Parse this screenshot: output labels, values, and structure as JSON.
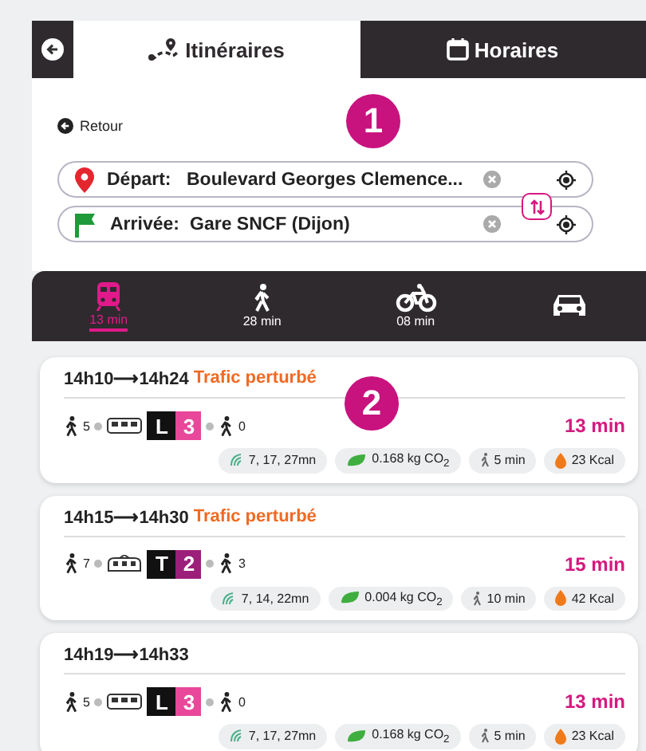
{
  "header": {
    "tabs": [
      {
        "label": "Itinéraires",
        "kind": "route",
        "selected": true
      },
      {
        "label": "Horaires",
        "kind": "calendar",
        "selected": false
      }
    ]
  },
  "form": {
    "back_link": "Retour",
    "fields": [
      {
        "kind": "start",
        "label": "Départ:",
        "value": "Boulevard Georges Clemence..."
      },
      {
        "kind": "end",
        "label": "Arrivée:",
        "value": "Gare SNCF (Dijon)"
      }
    ]
  },
  "modes": [
    {
      "kind": "transit",
      "label": "13 min",
      "selected": true
    },
    {
      "kind": "walk",
      "label": "28 min",
      "selected": false
    },
    {
      "kind": "bike",
      "label": "08 min",
      "selected": false
    },
    {
      "kind": "car",
      "selected": false
    }
  ],
  "callouts": [
    {
      "label": "1"
    },
    {
      "label": "2"
    }
  ],
  "results": [
    {
      "times": "14h10⟶14h24",
      "alert": "Trafic perturbé",
      "walk_before": "5",
      "kind": "bus",
      "line_letter": "L",
      "line_number": "3",
      "color": "#e8479a",
      "walk_after": "0",
      "duration": "13 min",
      "chips": [
        {
          "kind": "realtime",
          "text": "7, 17, 27mn"
        },
        {
          "kind": "co2",
          "text": "0.168 kg CO$_{2}$"
        },
        {
          "kind": "walk",
          "text": "5 min"
        },
        {
          "kind": "calories",
          "text": "23 Kcal"
        }
      ]
    },
    {
      "times": "14h15⟶14h30",
      "alert": "Trafic perturbé",
      "walk_before": "7",
      "kind": "tram",
      "line_letter": "T",
      "line_number": "2",
      "color": "#9c1f7a",
      "walk_after": "3",
      "duration": "15 min",
      "chips": [
        {
          "kind": "realtime",
          "text": "7, 14, 22mn"
        },
        {
          "kind": "co2",
          "text": "0.004 kg CO$_{2}$"
        },
        {
          "kind": "walk",
          "text": "10 min"
        },
        {
          "kind": "calories",
          "text": "42 Kcal"
        }
      ]
    },
    {
      "times": "14h19⟶14h33",
      "walk_before": "5",
      "kind": "bus",
      "line_letter": "L",
      "line_number": "3",
      "color": "#e8479a",
      "walk_after": "0",
      "duration": "13 min",
      "chips": [
        {
          "kind": "realtime",
          "text": "7, 17, 27mn"
        },
        {
          "kind": "co2",
          "text": "0.168 kg CO$_{2}$"
        },
        {
          "kind": "walk",
          "text": "5 min"
        },
        {
          "kind": "calories",
          "text": "23 Kcal"
        }
      ]
    }
  ]
}
